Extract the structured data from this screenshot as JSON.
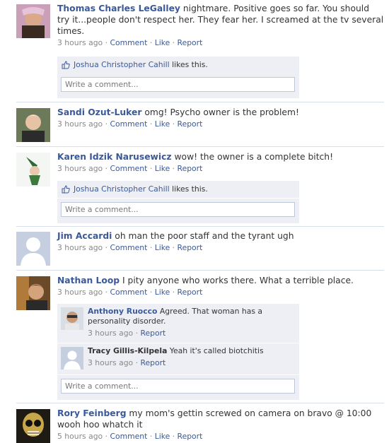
{
  "comment_placeholder": "Write a comment...",
  "meta_labels": {
    "comment": "Comment",
    "like": "Like",
    "report": "Report",
    "dot": "·",
    "likes_this": "likes this."
  },
  "posts": [
    {
      "author": "Thomas Charles LeGalley",
      "text": "nightmare. Positive goes so far. You should try it...people don't respect her. They fear her. I screamed at the tv several times.",
      "time": "3 hours ago",
      "liker": "Joshua Christopher Cahill"
    },
    {
      "author": "Sandi Ozut-Luker",
      "text": "omg! Psycho owner is the problem!",
      "time": "3 hours ago"
    },
    {
      "author": "Karen Idzik Narusewicz",
      "text": "wow! the owner is a complete bitch!",
      "time": "3 hours ago",
      "liker": "Joshua Christopher Cahill"
    },
    {
      "author": "Jim Accardi",
      "text": "oh man the poor staff and the tyrant ugh",
      "time": "3 hours ago"
    },
    {
      "author": "Nathan Loop",
      "text": "I pity anyone who works there. What a terrible place.",
      "time": "3 hours ago",
      "replies": [
        {
          "author": "Anthony Ruocco",
          "text": "Agreed. That woman has a personality disorder.",
          "time": "3 hours ago"
        },
        {
          "author": "Tracy Gillis-Kilpela",
          "text": "Yeah it's called biotchitis",
          "time": "3 hours ago"
        }
      ]
    },
    {
      "author": "Rory Feinberg",
      "text": "my mom's gettin screwed on camera on bravo @ 10:00 wooh hoo whatch it",
      "time": "5 hours ago"
    }
  ]
}
